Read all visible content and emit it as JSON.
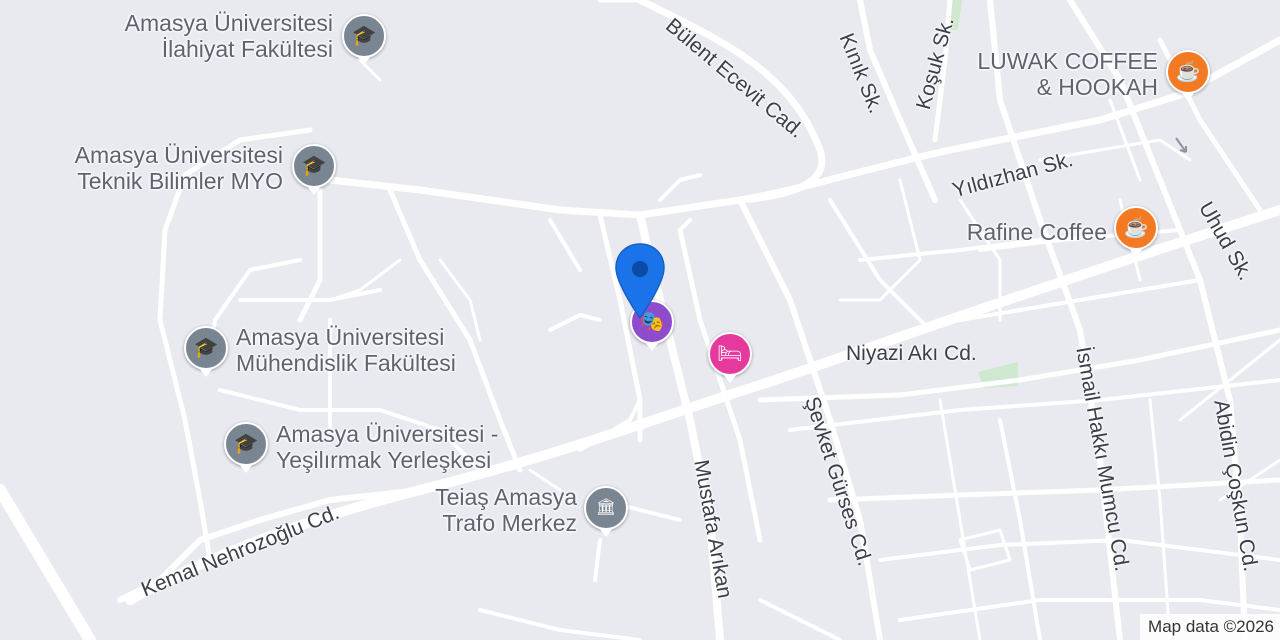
{
  "map": {
    "attribution": "Map data ©2026",
    "colors": {
      "background": "#e8eaf0",
      "road": "#ffffff",
      "park": "#cfe8d0",
      "education_pin": "#7a8592",
      "cafe_pin": "#f37a22",
      "hotel_pin": "#e5399e",
      "theater_pin": "#8e4ccc",
      "location_pin": "#1a73e8"
    },
    "pois": [
      {
        "name": "Amasya Üniversitesi\nİlahiyat Fakültesi",
        "icon": "graduation-cap-icon"
      },
      {
        "name": "Amasya Üniversitesi\nTeknik Bilimler MYO",
        "icon": "graduation-cap-icon"
      },
      {
        "name": "Amasya Üniversitesi\nMühendislik Fakültesi",
        "icon": "graduation-cap-icon"
      },
      {
        "name": "Amasya Üniversitesi -\nYeşilırmak Yerleşkesi",
        "icon": "graduation-cap-icon"
      },
      {
        "name": "Teiaş Amasya\nTrafo Merkez",
        "icon": "government-building-icon"
      },
      {
        "name": "LUWAK COFFEE\n& HOOKAH",
        "icon": "coffee-cup-icon"
      },
      {
        "name": "Rafine Coffee",
        "icon": "coffee-cup-icon"
      }
    ],
    "unlabeled_pins": [
      {
        "type": "theater",
        "icon": "theater-masks-icon"
      },
      {
        "type": "hotel",
        "icon": "bed-icon"
      },
      {
        "type": "current-location",
        "icon": "location-pin-icon"
      }
    ],
    "streets": [
      "Bülent Ecevit Cad.",
      "Kınık Sk.",
      "Koşuk Sk.",
      "Yıldızhan Sk.",
      "Uhud Sk.",
      "Niyazi Akı Cd.",
      "İsmail Hakkı Mumcu Cd.",
      "Abidin Çoşkun Cd.",
      "Şevket Gürses Cd.",
      "Mustafa Arıkan",
      "Kemal Nehrozoğlu Cd."
    ]
  }
}
